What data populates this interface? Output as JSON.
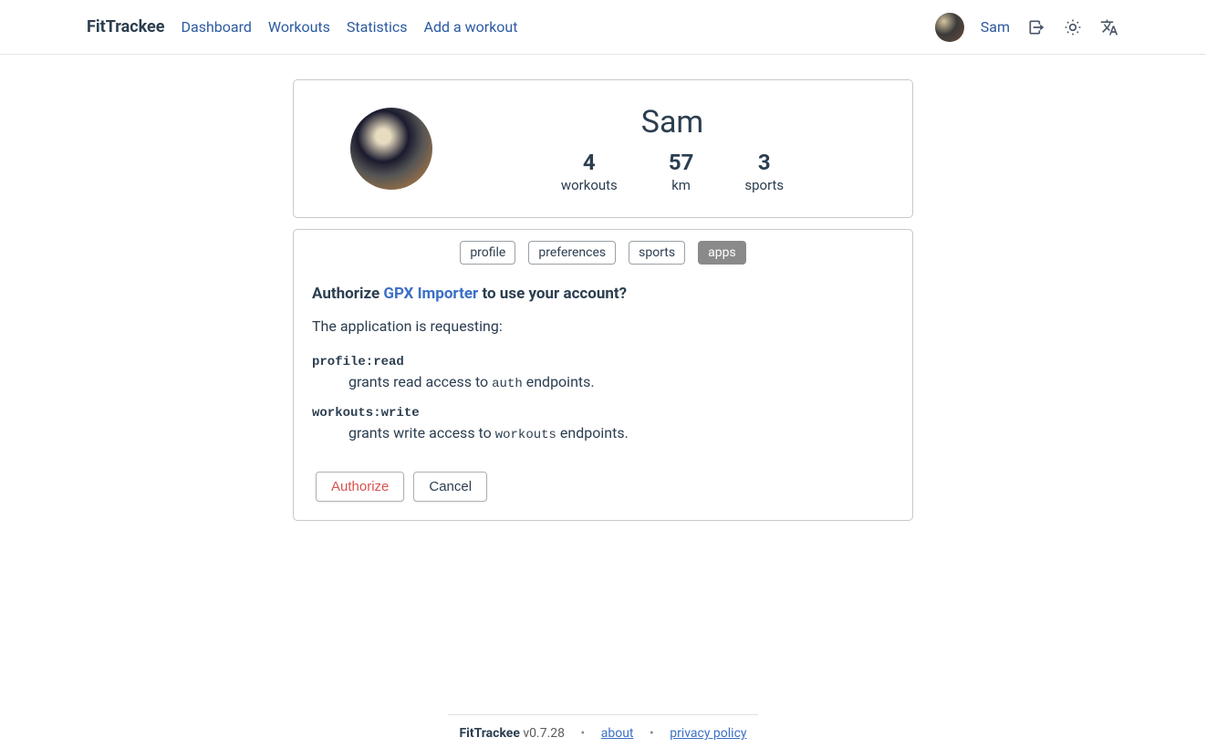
{
  "header": {
    "brand": "FitTrackee",
    "nav": {
      "dashboard": "Dashboard",
      "workouts": "Workouts",
      "statistics": "Statistics",
      "add_workout": "Add a workout"
    },
    "user": "Sam"
  },
  "profile": {
    "name": "Sam",
    "stats": {
      "workouts_value": "4",
      "workouts_label": "workouts",
      "km_value": "57",
      "km_label": "km",
      "sports_value": "3",
      "sports_label": "sports"
    }
  },
  "tabs": {
    "profile": "profile",
    "preferences": "preferences",
    "sports": "sports",
    "apps": "apps"
  },
  "auth": {
    "heading_prefix": "Authorize ",
    "app_name": "GPX Importer",
    "heading_suffix": " to use your account?",
    "requesting": "The application is requesting:",
    "scopes": [
      {
        "name": "profile:read",
        "desc_prefix": "grants read access to ",
        "desc_code": "auth",
        "desc_suffix": " endpoints."
      },
      {
        "name": "workouts:write",
        "desc_prefix": "grants write access to ",
        "desc_code": "workouts",
        "desc_suffix": " endpoints."
      }
    ],
    "authorize_btn": "Authorize",
    "cancel_btn": "Cancel"
  },
  "footer": {
    "brand": "FitTrackee",
    "version": " v0.7.28",
    "about": "about",
    "privacy": "privacy policy"
  }
}
